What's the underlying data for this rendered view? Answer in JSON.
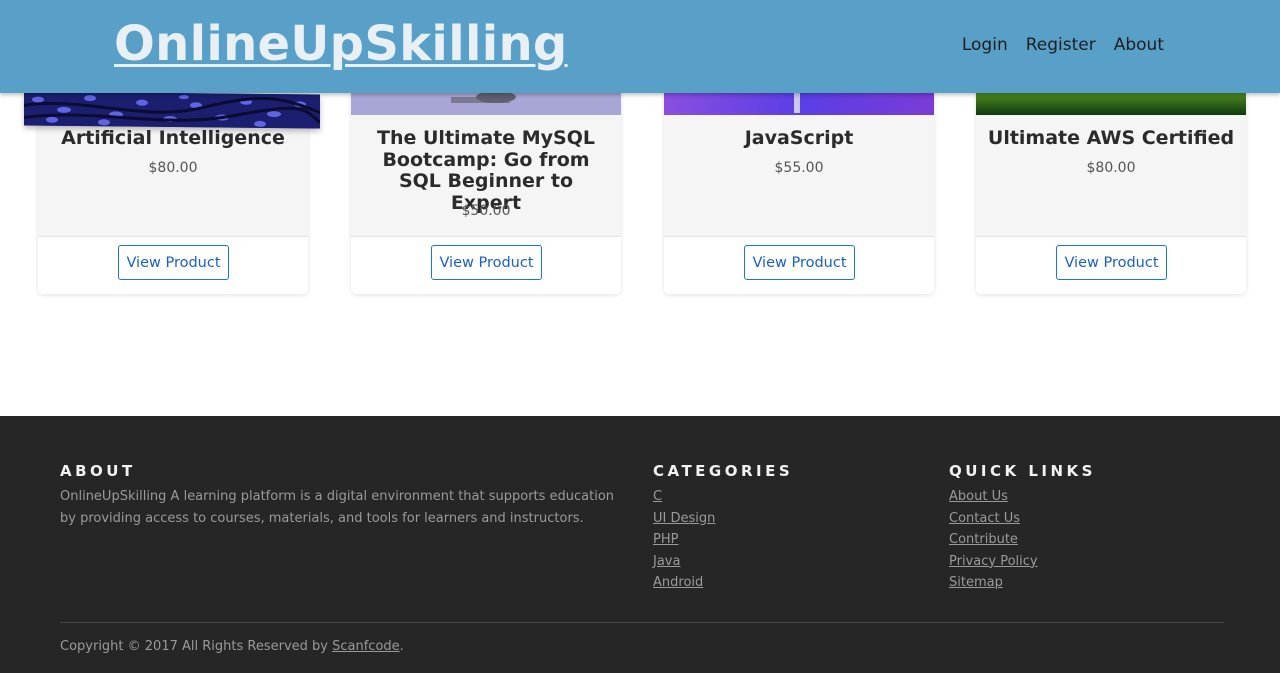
{
  "header": {
    "brand": "OnlineUpSkilling",
    "nav": [
      "Login",
      "Register",
      "About"
    ]
  },
  "products": [
    {
      "title": "Artificial Intelligence",
      "price": "$80.00",
      "button": "View Product"
    },
    {
      "title": "The Ultimate MySQL Bootcamp: Go from SQL Beginner to Expert",
      "price": "$50.00",
      "button": "View Product"
    },
    {
      "title": "JavaScript",
      "price": "$55.00",
      "button": "View Product"
    },
    {
      "title": "Ultimate AWS Certified",
      "price": "$80.00",
      "button": "View Product"
    }
  ],
  "footer": {
    "about_heading": "ABOUT",
    "about_text": "OnlineUpSkilling A learning platform is a digital environment that supports education by providing access to courses, materials, and tools for learners and instructors.",
    "categories_heading": "CATEGORIES",
    "categories": [
      "C",
      "UI Design",
      "PHP",
      "Java",
      "Android"
    ],
    "quicklinks_heading": "QUICK LINKS",
    "quicklinks": [
      "About Us",
      "Contact Us",
      "Contribute",
      "Privacy Policy",
      "Sitemap"
    ],
    "copyright_prefix": "Copyright © 2017 All Rights Reserved by ",
    "copyright_link": "Scanfcode",
    "copyright_suffix": "."
  },
  "colors": {
    "header_bg": "#58a0c8",
    "footer_bg": "#262626",
    "button_border": "#1a73e8"
  }
}
